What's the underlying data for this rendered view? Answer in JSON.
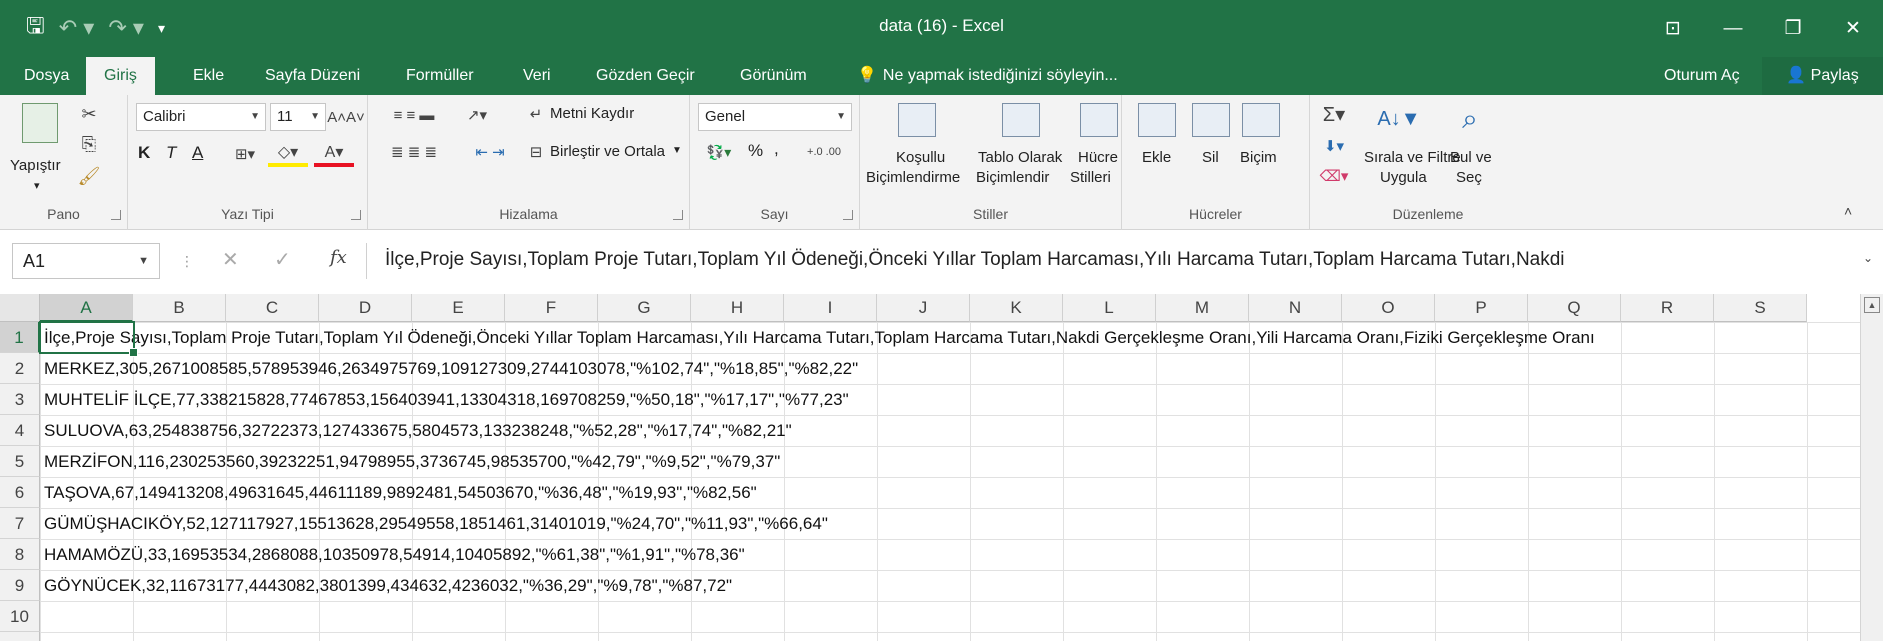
{
  "titlebar": {
    "title": "data (16) - Excel",
    "qat": {
      "save_icon": "save-icon",
      "undo_icon": "undo-icon",
      "redo_icon": "redo-icon"
    }
  },
  "tabs": [
    {
      "label": "Dosya"
    },
    {
      "label": "Giriş"
    },
    {
      "label": "Ekle"
    },
    {
      "label": "Sayfa Düzeni"
    },
    {
      "label": "Formüller"
    },
    {
      "label": "Veri"
    },
    {
      "label": "Gözden Geçir"
    },
    {
      "label": "Görünüm"
    }
  ],
  "tellme": "Ne yapmak istediğinizi söyleyin...",
  "account": {
    "signin": "Oturum Aç",
    "share": "Paylaş"
  },
  "ribbon": {
    "pano": {
      "label": "Pano",
      "paste": "Yapıştır"
    },
    "font": {
      "label": "Yazı Tipi",
      "name": "Calibri",
      "size": "11",
      "bold": "K",
      "italic": "T",
      "underline": "A"
    },
    "align": {
      "label": "Hizalama",
      "wrap": "Metni Kaydır",
      "merge": "Birleştir ve Ortala"
    },
    "number": {
      "label": "Sayı",
      "format": "Genel",
      "percent": "%"
    },
    "styles": {
      "label": "Stiller",
      "conditional_1": "Koşullu",
      "conditional_2": "Biçimlendirme",
      "table_1": "Tablo Olarak",
      "table_2": "Biçimlendir",
      "cell_1": "Hücre",
      "cell_2": "Stilleri"
    },
    "cells": {
      "label": "Hücreler",
      "insert": "Ekle",
      "delete": "Sil",
      "format": "Biçim"
    },
    "editing": {
      "label": "Düzenleme",
      "sort_1": "Sırala ve Filtre",
      "sort_2": "Uygula",
      "find_1": "Bul ve",
      "find_2": "Seç"
    }
  },
  "formula_bar": {
    "name_box": "A1",
    "fx": "fx",
    "content": "İlçe,Proje Sayısı,Toplam Proje Tutarı,Toplam Yıl Ödeneği,Önceki Yıllar Toplam Harcaması,Yılı Harcama Tutarı,Toplam Harcama Tutarı,Nakdi"
  },
  "sheet": {
    "columns": [
      "A",
      "B",
      "C",
      "D",
      "E",
      "F",
      "G",
      "H",
      "I",
      "J",
      "K",
      "L",
      "M",
      "N",
      "O",
      "P",
      "Q",
      "R",
      "S"
    ],
    "rows": [
      {
        "num": "1",
        "text": "İlçe,Proje Sayısı,Toplam Proje Tutarı,Toplam Yıl Ödeneği,Önceki Yıllar Toplam Harcaması,Yılı Harcama Tutarı,Toplam Harcama Tutarı,Nakdi Gerçekleşme Oranı,Yili Harcama Oranı,Fiziki Gerçekleşme Oranı"
      },
      {
        "num": "2",
        "text": "MERKEZ,305,2671008585,578953946,2634975769,109127309,2744103078,\"%102,74\",\"%18,85\",\"%82,22\""
      },
      {
        "num": "3",
        "text": "MUHTELİF İLÇE,77,338215828,77467853,156403941,13304318,169708259,\"%50,18\",\"%17,17\",\"%77,23\""
      },
      {
        "num": "4",
        "text": "SULUOVA,63,254838756,32722373,127433675,5804573,133238248,\"%52,28\",\"%17,74\",\"%82,21\""
      },
      {
        "num": "5",
        "text": "MERZİFON,116,230253560,39232251,94798955,3736745,98535700,\"%42,79\",\"%9,52\",\"%79,37\""
      },
      {
        "num": "6",
        "text": "TAŞOVA,67,149413208,49631645,44611189,9892481,54503670,\"%36,48\",\"%19,93\",\"%82,56\""
      },
      {
        "num": "7",
        "text": "GÜMÜŞHACIKÖY,52,127117927,15513628,29549558,1851461,31401019,\"%24,70\",\"%11,93\",\"%66,64\""
      },
      {
        "num": "8",
        "text": "HAMAMÖZÜ,33,16953534,2868088,10350978,54914,10405892,\"%61,38\",\"%1,91\",\"%78,36\""
      },
      {
        "num": "9",
        "text": "GÖYNÜCEK,32,11673177,4443082,3801399,434632,4236032,\"%36,29\",\"%9,78\",\"%87,72\""
      },
      {
        "num": "10",
        "text": ""
      },
      {
        "num": "11",
        "text": ""
      }
    ]
  }
}
